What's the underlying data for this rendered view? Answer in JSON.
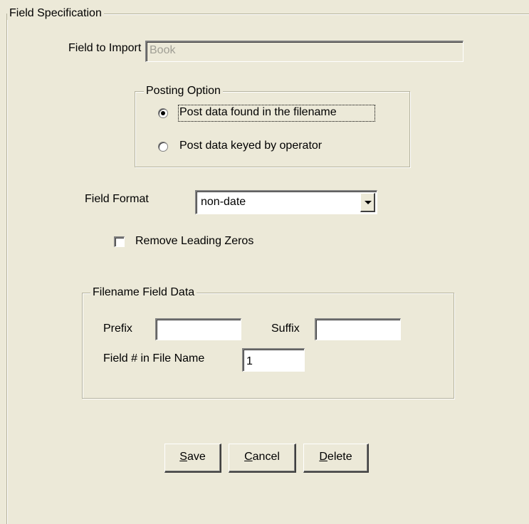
{
  "field_specification": {
    "caption": "Field Specification",
    "field_to_import_label": "Field to Import",
    "field_to_import_value": "Book"
  },
  "posting_option": {
    "caption": "Posting Option",
    "options": [
      {
        "label": "Post data found in the filename",
        "selected": true
      },
      {
        "label": "Post data keyed by operator",
        "selected": false
      }
    ]
  },
  "field_format": {
    "label": "Field Format",
    "value": "non-date"
  },
  "remove_leading_zeros": {
    "label": "Remove Leading Zeros",
    "checked": false
  },
  "filename_field_data": {
    "caption": "Filename Field Data",
    "prefix_label": "Prefix",
    "prefix_value": "",
    "suffix_label": "Suffix",
    "suffix_value": "",
    "field_number_label": "Field # in File Name",
    "field_number_value": "1"
  },
  "buttons": {
    "save": {
      "accel": "S",
      "rest": "ave"
    },
    "cancel": {
      "accel": "C",
      "rest": "ancel"
    },
    "delete": {
      "accel": "D",
      "rest": "elete"
    }
  }
}
